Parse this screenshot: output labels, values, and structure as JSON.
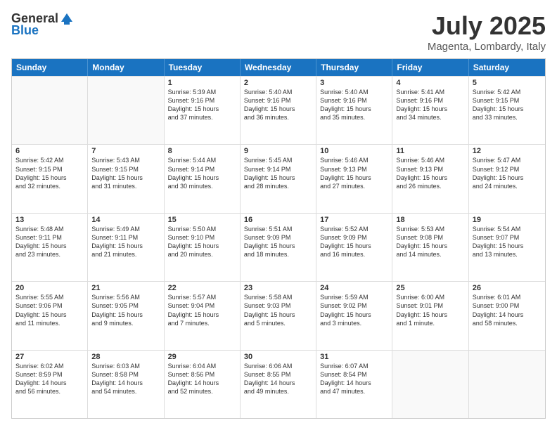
{
  "header": {
    "logo_general": "General",
    "logo_blue": "Blue",
    "month_year": "July 2025",
    "location": "Magenta, Lombardy, Italy"
  },
  "calendar": {
    "days_of_week": [
      "Sunday",
      "Monday",
      "Tuesday",
      "Wednesday",
      "Thursday",
      "Friday",
      "Saturday"
    ],
    "rows": [
      [
        {
          "day": "",
          "text": "",
          "empty": true
        },
        {
          "day": "",
          "text": "",
          "empty": true
        },
        {
          "day": "1",
          "text": "Sunrise: 5:39 AM\nSunset: 9:16 PM\nDaylight: 15 hours\nand 37 minutes.",
          "empty": false
        },
        {
          "day": "2",
          "text": "Sunrise: 5:40 AM\nSunset: 9:16 PM\nDaylight: 15 hours\nand 36 minutes.",
          "empty": false
        },
        {
          "day": "3",
          "text": "Sunrise: 5:40 AM\nSunset: 9:16 PM\nDaylight: 15 hours\nand 35 minutes.",
          "empty": false
        },
        {
          "day": "4",
          "text": "Sunrise: 5:41 AM\nSunset: 9:16 PM\nDaylight: 15 hours\nand 34 minutes.",
          "empty": false
        },
        {
          "day": "5",
          "text": "Sunrise: 5:42 AM\nSunset: 9:15 PM\nDaylight: 15 hours\nand 33 minutes.",
          "empty": false
        }
      ],
      [
        {
          "day": "6",
          "text": "Sunrise: 5:42 AM\nSunset: 9:15 PM\nDaylight: 15 hours\nand 32 minutes.",
          "empty": false
        },
        {
          "day": "7",
          "text": "Sunrise: 5:43 AM\nSunset: 9:15 PM\nDaylight: 15 hours\nand 31 minutes.",
          "empty": false
        },
        {
          "day": "8",
          "text": "Sunrise: 5:44 AM\nSunset: 9:14 PM\nDaylight: 15 hours\nand 30 minutes.",
          "empty": false
        },
        {
          "day": "9",
          "text": "Sunrise: 5:45 AM\nSunset: 9:14 PM\nDaylight: 15 hours\nand 28 minutes.",
          "empty": false
        },
        {
          "day": "10",
          "text": "Sunrise: 5:46 AM\nSunset: 9:13 PM\nDaylight: 15 hours\nand 27 minutes.",
          "empty": false
        },
        {
          "day": "11",
          "text": "Sunrise: 5:46 AM\nSunset: 9:13 PM\nDaylight: 15 hours\nand 26 minutes.",
          "empty": false
        },
        {
          "day": "12",
          "text": "Sunrise: 5:47 AM\nSunset: 9:12 PM\nDaylight: 15 hours\nand 24 minutes.",
          "empty": false
        }
      ],
      [
        {
          "day": "13",
          "text": "Sunrise: 5:48 AM\nSunset: 9:11 PM\nDaylight: 15 hours\nand 23 minutes.",
          "empty": false
        },
        {
          "day": "14",
          "text": "Sunrise: 5:49 AM\nSunset: 9:11 PM\nDaylight: 15 hours\nand 21 minutes.",
          "empty": false
        },
        {
          "day": "15",
          "text": "Sunrise: 5:50 AM\nSunset: 9:10 PM\nDaylight: 15 hours\nand 20 minutes.",
          "empty": false
        },
        {
          "day": "16",
          "text": "Sunrise: 5:51 AM\nSunset: 9:09 PM\nDaylight: 15 hours\nand 18 minutes.",
          "empty": false
        },
        {
          "day": "17",
          "text": "Sunrise: 5:52 AM\nSunset: 9:09 PM\nDaylight: 15 hours\nand 16 minutes.",
          "empty": false
        },
        {
          "day": "18",
          "text": "Sunrise: 5:53 AM\nSunset: 9:08 PM\nDaylight: 15 hours\nand 14 minutes.",
          "empty": false
        },
        {
          "day": "19",
          "text": "Sunrise: 5:54 AM\nSunset: 9:07 PM\nDaylight: 15 hours\nand 13 minutes.",
          "empty": false
        }
      ],
      [
        {
          "day": "20",
          "text": "Sunrise: 5:55 AM\nSunset: 9:06 PM\nDaylight: 15 hours\nand 11 minutes.",
          "empty": false
        },
        {
          "day": "21",
          "text": "Sunrise: 5:56 AM\nSunset: 9:05 PM\nDaylight: 15 hours\nand 9 minutes.",
          "empty": false
        },
        {
          "day": "22",
          "text": "Sunrise: 5:57 AM\nSunset: 9:04 PM\nDaylight: 15 hours\nand 7 minutes.",
          "empty": false
        },
        {
          "day": "23",
          "text": "Sunrise: 5:58 AM\nSunset: 9:03 PM\nDaylight: 15 hours\nand 5 minutes.",
          "empty": false
        },
        {
          "day": "24",
          "text": "Sunrise: 5:59 AM\nSunset: 9:02 PM\nDaylight: 15 hours\nand 3 minutes.",
          "empty": false
        },
        {
          "day": "25",
          "text": "Sunrise: 6:00 AM\nSunset: 9:01 PM\nDaylight: 15 hours\nand 1 minute.",
          "empty": false
        },
        {
          "day": "26",
          "text": "Sunrise: 6:01 AM\nSunset: 9:00 PM\nDaylight: 14 hours\nand 58 minutes.",
          "empty": false
        }
      ],
      [
        {
          "day": "27",
          "text": "Sunrise: 6:02 AM\nSunset: 8:59 PM\nDaylight: 14 hours\nand 56 minutes.",
          "empty": false
        },
        {
          "day": "28",
          "text": "Sunrise: 6:03 AM\nSunset: 8:58 PM\nDaylight: 14 hours\nand 54 minutes.",
          "empty": false
        },
        {
          "day": "29",
          "text": "Sunrise: 6:04 AM\nSunset: 8:56 PM\nDaylight: 14 hours\nand 52 minutes.",
          "empty": false
        },
        {
          "day": "30",
          "text": "Sunrise: 6:06 AM\nSunset: 8:55 PM\nDaylight: 14 hours\nand 49 minutes.",
          "empty": false
        },
        {
          "day": "31",
          "text": "Sunrise: 6:07 AM\nSunset: 8:54 PM\nDaylight: 14 hours\nand 47 minutes.",
          "empty": false
        },
        {
          "day": "",
          "text": "",
          "empty": true
        },
        {
          "day": "",
          "text": "",
          "empty": true
        }
      ]
    ]
  }
}
